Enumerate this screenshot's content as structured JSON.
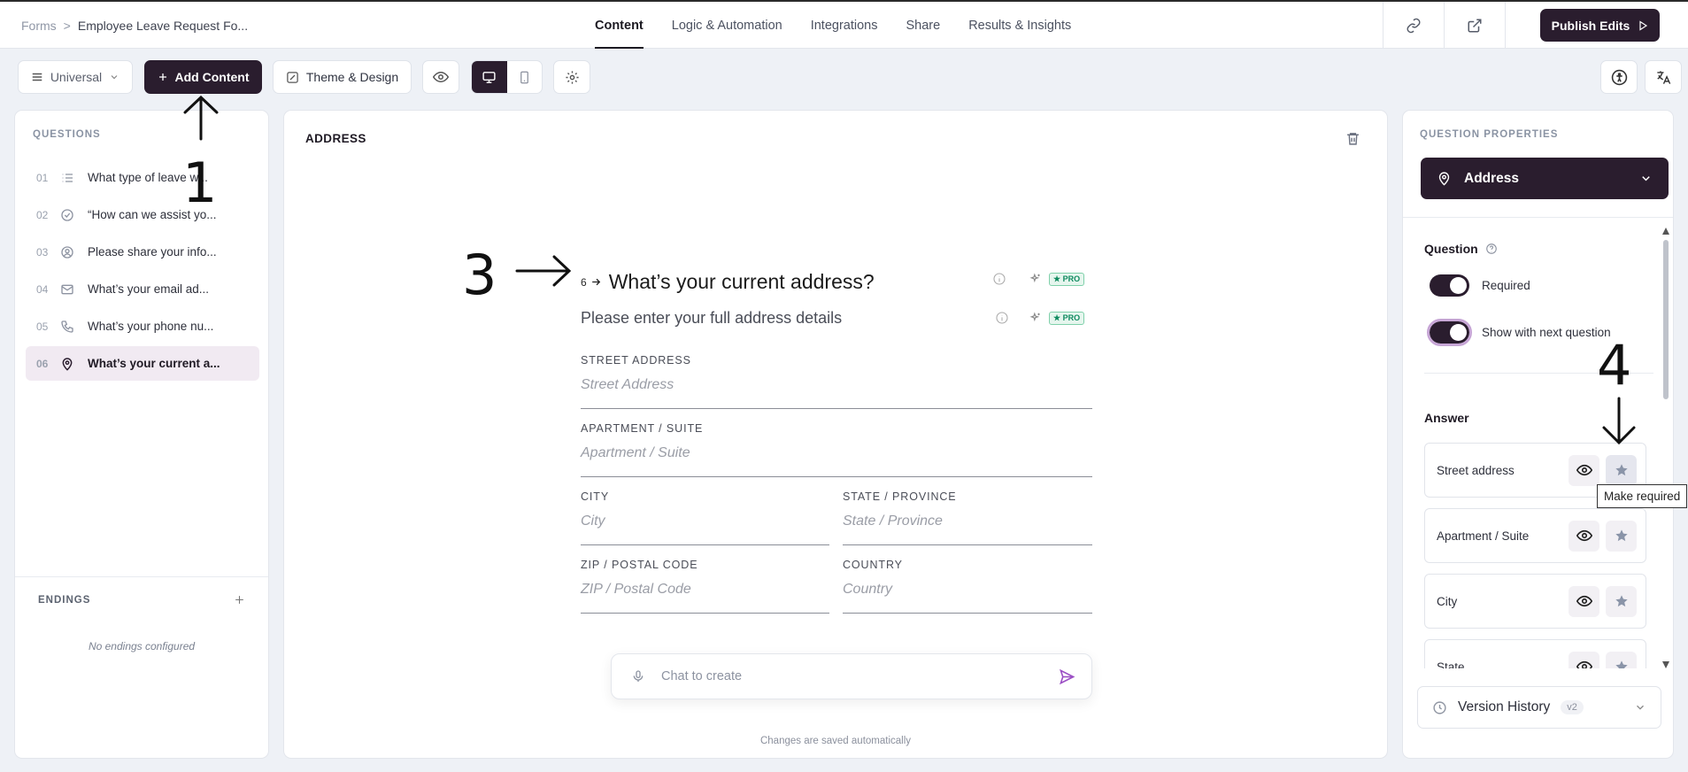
{
  "breadcrumb": {
    "root": "Forms",
    "sep": ">",
    "current": "Employee Leave Request Fo..."
  },
  "tabs": [
    "Content",
    "Logic & Automation",
    "Integrations",
    "Share",
    "Results & Insights"
  ],
  "active_tab": "Content",
  "header": {
    "publish_label": "Publish Edits"
  },
  "toolbar": {
    "universal_label": "Universal",
    "add_content_label": "Add Content",
    "theme_label": "Theme & Design"
  },
  "questions_panel": {
    "title": "QUESTIONS",
    "items": [
      {
        "num": "01",
        "icon": "list-icon",
        "text": "What type of leave w..."
      },
      {
        "num": "02",
        "icon": "check-circle-icon",
        "text": "“How can we assist yo..."
      },
      {
        "num": "03",
        "icon": "user-circle-icon",
        "text": "Please share your info..."
      },
      {
        "num": "04",
        "icon": "mail-icon",
        "text": "What’s your email ad..."
      },
      {
        "num": "05",
        "icon": "phone-icon",
        "text": "What’s your phone nu..."
      },
      {
        "num": "06",
        "icon": "map-pin-icon",
        "text": "What’s your current a..."
      }
    ],
    "selected_index": 5,
    "endings_title": "ENDINGS",
    "no_endings": "No endings configured"
  },
  "editor": {
    "section_title": "ADDRESS",
    "question_number": "6",
    "question_title": "What’s your current address?",
    "question_desc": "Please enter your full address details",
    "pro_badge": "★ PRO",
    "fields": {
      "street": {
        "label": "STREET ADDRESS",
        "placeholder": "Street Address"
      },
      "apt": {
        "label": "APARTMENT / SUITE",
        "placeholder": "Apartment / Suite"
      },
      "city": {
        "label": "CITY",
        "placeholder": "City"
      },
      "state": {
        "label": "STATE / PROVINCE",
        "placeholder": "State / Province"
      },
      "zip": {
        "label": "ZIP / POSTAL CODE",
        "placeholder": "ZIP / Postal Code"
      },
      "country": {
        "label": "COUNTRY",
        "placeholder": "Country"
      }
    },
    "chat_placeholder": "Chat to create",
    "saved_note": "Changes are saved automatically"
  },
  "properties": {
    "title": "QUESTION PROPERTIES",
    "type_label": "Address",
    "question_heading": "Question",
    "required_label": "Required",
    "show_next_label": "Show with next question",
    "answer_heading": "Answer",
    "answers": [
      "Street address",
      "Apartment / Suite",
      "City",
      "State"
    ],
    "tooltip": "Make required",
    "version_label": "Version History",
    "version_badge": "v2"
  },
  "annotations": {
    "a1": "1",
    "a3": "3",
    "a4": "4"
  }
}
